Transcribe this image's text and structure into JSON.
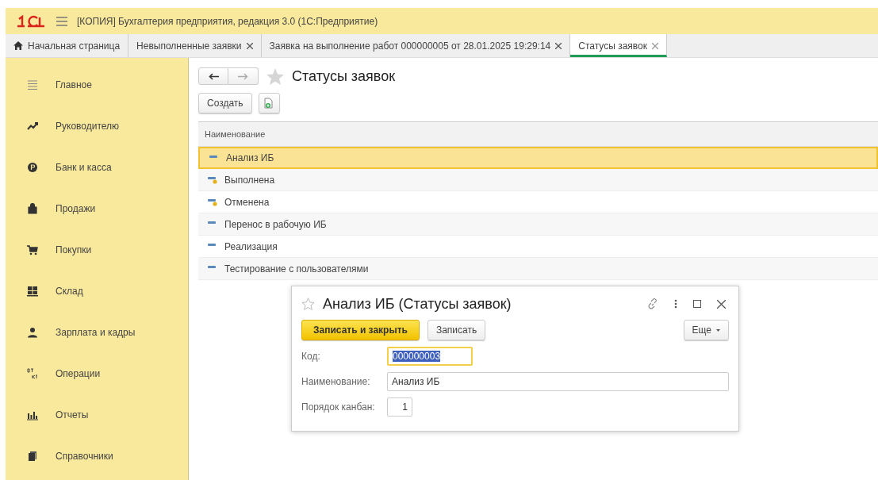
{
  "window": {
    "title": "[КОПИЯ] Бухгалтерия предприятия, редакция 3.0  (1С:Предприятие)"
  },
  "tabs": [
    {
      "label": "Начальная страница",
      "selected": false,
      "home": true,
      "closable": false
    },
    {
      "label": "Невыполненные заявки",
      "selected": false,
      "home": false,
      "closable": true
    },
    {
      "label": "Заявка на выполнение работ 000000005 от 28.01.2025 19:29:14",
      "selected": false,
      "home": false,
      "closable": true
    },
    {
      "label": "Статусы заявок",
      "selected": true,
      "home": false,
      "closable": true
    }
  ],
  "sidebar": {
    "items": [
      {
        "label": "Главное",
        "kind": "menu"
      },
      {
        "label": "Руководителю",
        "kind": "trend"
      },
      {
        "label": "Банк и касса",
        "kind": "coin"
      },
      {
        "label": "Продажи",
        "kind": "bag"
      },
      {
        "label": "Покупки",
        "kind": "cart"
      },
      {
        "label": "Склад",
        "kind": "warehouse"
      },
      {
        "label": "Зарплата и кадры",
        "kind": "person"
      },
      {
        "label": "Операции",
        "kind": "dtkt"
      },
      {
        "label": "Отчеты",
        "kind": "chart"
      },
      {
        "label": "Справочники",
        "kind": "books"
      }
    ]
  },
  "list": {
    "title": "Статусы заявок",
    "create_button": "Создать",
    "table": {
      "columns": [
        "Наименование"
      ],
      "rows": [
        {
          "name": "Анализ ИБ",
          "kind": "plain",
          "selected": true
        },
        {
          "name": "Выполнена",
          "kind": "predefined",
          "selected": false
        },
        {
          "name": "Отменена",
          "kind": "predefined",
          "selected": false
        },
        {
          "name": "Перенос в рабочую ИБ",
          "kind": "plain",
          "selected": false
        },
        {
          "name": "Реализация",
          "kind": "plain",
          "selected": false
        },
        {
          "name": "Тестирование с пользователями",
          "kind": "plain",
          "selected": false
        }
      ]
    }
  },
  "dialog": {
    "title": "Анализ ИБ (Статусы заявок)",
    "buttons": [
      {
        "label": "Записать и закрыть",
        "kind": "primary"
      },
      {
        "label": "Записать",
        "kind": "normal"
      }
    ],
    "more_button": "Еще",
    "fields": [
      {
        "label": "Код:",
        "value": "000000003",
        "kind": "short",
        "focused": true
      },
      {
        "label": "Наименование:",
        "value": "Анализ ИБ",
        "kind": "wide",
        "focused": false
      },
      {
        "label": "Порядок канбан:",
        "value": "1",
        "kind": "number",
        "focused": false
      }
    ]
  }
}
